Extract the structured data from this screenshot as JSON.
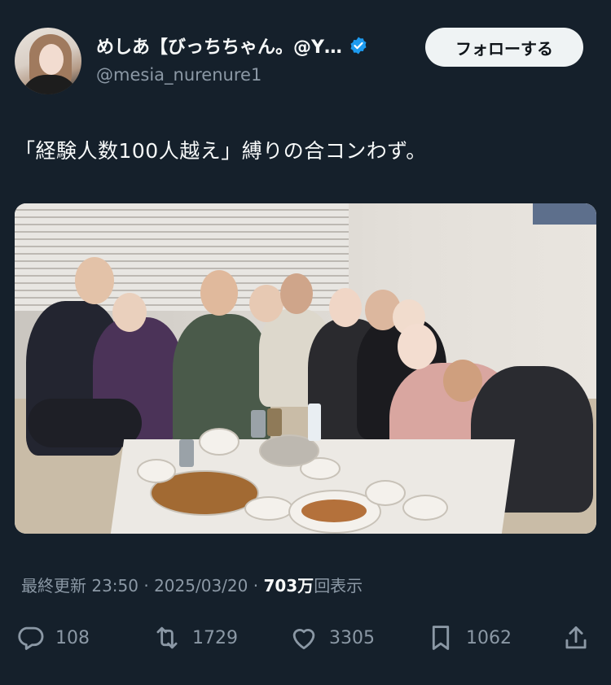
{
  "tweet": {
    "author": {
      "display_name": "めしあ【びっちちゃん。@Y…",
      "handle": "@mesia_nurenure1",
      "verified": true
    },
    "follow_label": "フォローする",
    "text": "「経験人数100人越え」縛りの合コンわず。",
    "media": {
      "description_icon": "photo"
    },
    "meta": {
      "prefix": "最終更新",
      "time": "23:50",
      "sep1": "·",
      "date": "2025/03/20",
      "sep2": "·",
      "views": "703万",
      "views_suffix": "回表示"
    },
    "actions": {
      "replies": "108",
      "retweets": "1729",
      "likes": "3305",
      "bookmarks": "1062"
    }
  },
  "colors": {
    "background": "#15202b",
    "verified": "#1d9bf0",
    "muted": "#8b98a5"
  }
}
